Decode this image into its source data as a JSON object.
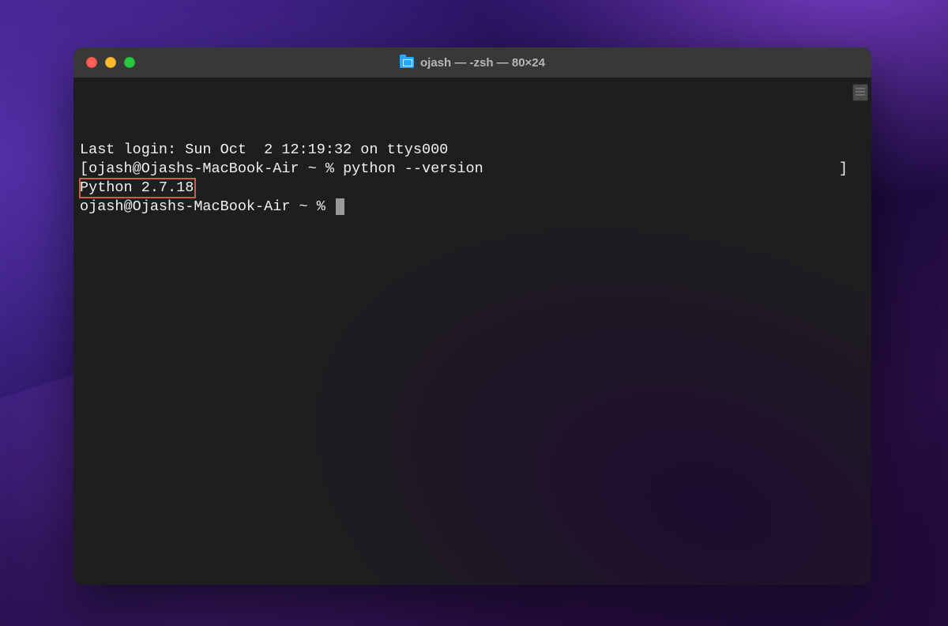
{
  "window": {
    "title": "ojash — -zsh — 80×24"
  },
  "terminal": {
    "last_login": "Last login: Sun Oct  2 12:19:32 on ttys000",
    "prompt1_prefix": "ojash@Ojashs-MacBook-Air ~ % ",
    "command1": "python --version",
    "output1": "Python 2.7.18",
    "prompt2": "ojash@Ojashs-MacBook-Air ~ % ",
    "left_bracket": "[",
    "right_bracket": "]"
  }
}
